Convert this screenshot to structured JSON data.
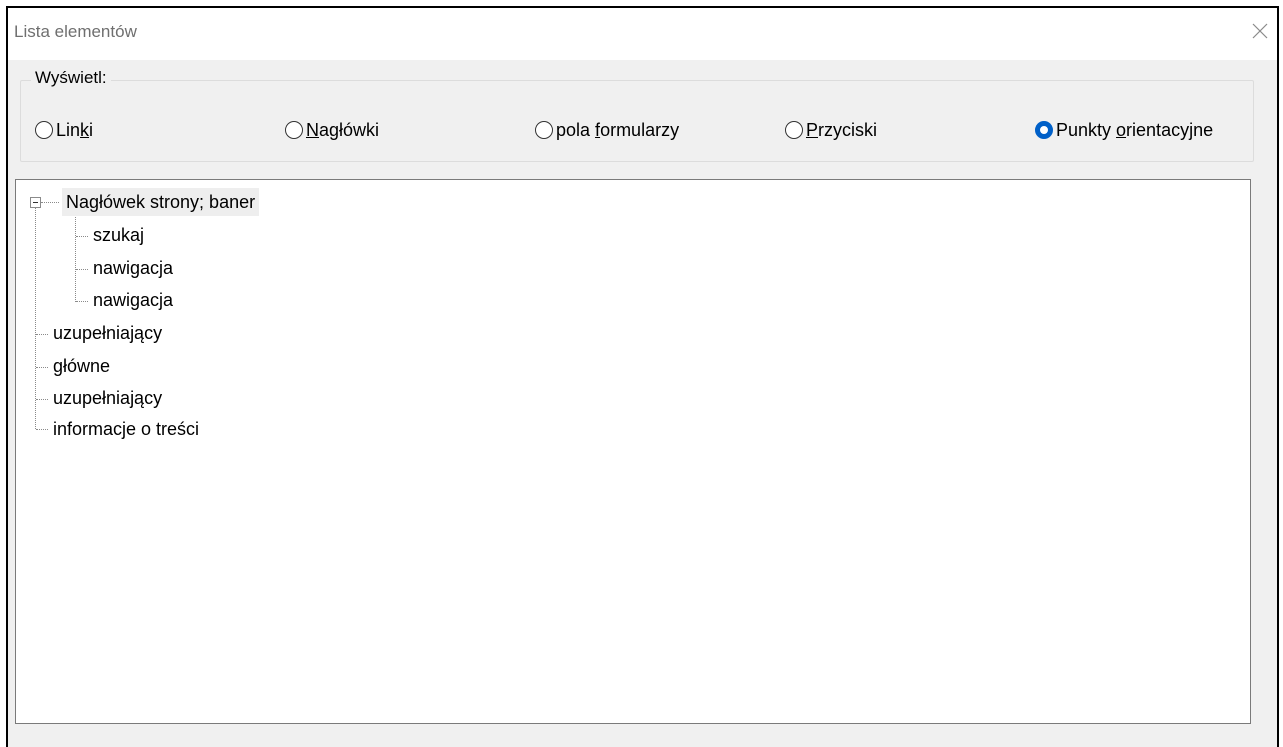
{
  "window": {
    "title": "Lista elementów"
  },
  "display_group": {
    "legend": "Wyświetl:",
    "options": [
      {
        "pre": "Lin",
        "key": "k",
        "post": "i",
        "selected": false
      },
      {
        "pre": "",
        "key": "N",
        "post": "agłówki",
        "selected": false
      },
      {
        "pre": "pola ",
        "key": "f",
        "post": "ormularzy",
        "selected": false
      },
      {
        "pre": "",
        "key": "P",
        "post": "rzyciski",
        "selected": false
      },
      {
        "pre": "Punkty ",
        "key": "o",
        "post": "rientacyjne",
        "selected": true
      }
    ]
  },
  "tree": {
    "items": [
      {
        "label": "Nagłówek strony; baner",
        "level": 0,
        "expanded": true,
        "selected": true
      },
      {
        "label": "szukaj",
        "level": 1
      },
      {
        "label": "nawigacja",
        "level": 1
      },
      {
        "label": "nawigacja",
        "level": 1
      },
      {
        "label": "uzupełniający",
        "level": 0
      },
      {
        "label": "główne",
        "level": 0
      },
      {
        "label": "uzupełniający",
        "level": 0
      },
      {
        "label": "informacje o treści",
        "level": 0
      }
    ]
  },
  "colors": {
    "accent": "#0060c8",
    "dialog_bg": "#f0f0f0",
    "title_text": "#6f6f6f"
  },
  "icons": {
    "close": "close-icon",
    "expander": "collapse-minus-icon"
  }
}
